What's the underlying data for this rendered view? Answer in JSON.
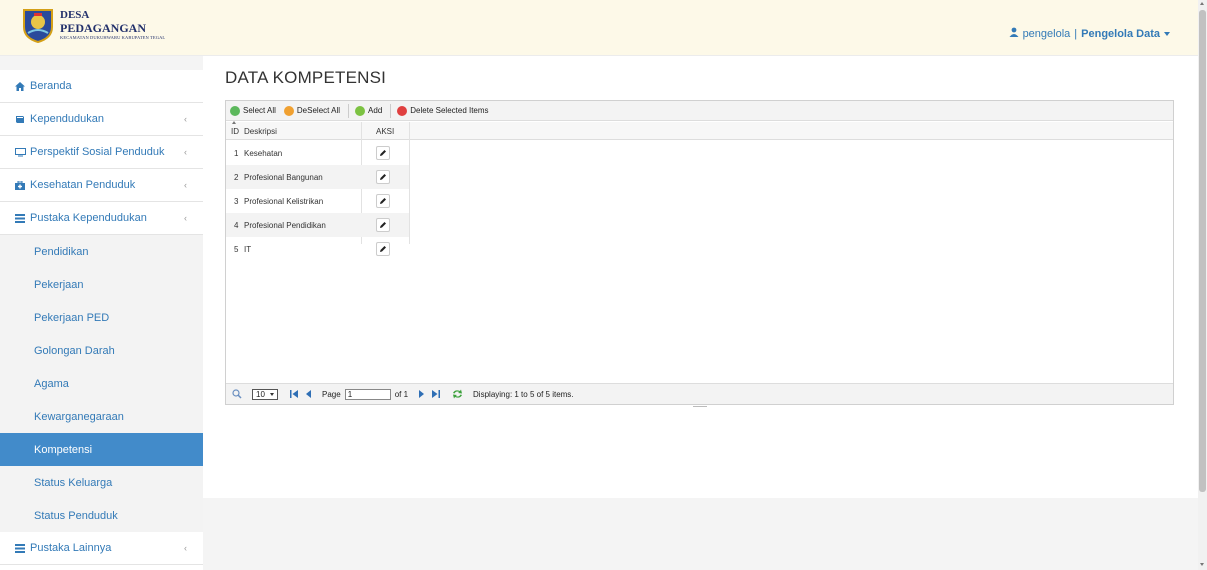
{
  "header": {
    "logo_line1": "DESA",
    "logo_line2": "PEDAGANGAN",
    "logo_line3": "KECAMATAN DUKUHWARU KABUPATEN TEGAL",
    "username": "pengelola",
    "separator": "|",
    "role": "Pengelola Data"
  },
  "sidebar": {
    "items": [
      {
        "label": "Beranda",
        "icon": "home-icon"
      },
      {
        "label": "Kependudukan",
        "icon": "book-icon"
      },
      {
        "label": "Perspektif Sosial Penduduk",
        "icon": "monitor-icon"
      },
      {
        "label": "Kesehatan Penduduk",
        "icon": "medkit-icon"
      },
      {
        "label": "Pustaka Kependudukan",
        "icon": "list-icon"
      }
    ],
    "sub_items": [
      {
        "label": "Pendidikan"
      },
      {
        "label": "Pekerjaan"
      },
      {
        "label": "Pekerjaan PED"
      },
      {
        "label": "Golongan Darah"
      },
      {
        "label": "Agama"
      },
      {
        "label": "Kewarganegaraan"
      },
      {
        "label": "Kompetensi",
        "active": true
      },
      {
        "label": "Status Keluarga"
      },
      {
        "label": "Status Penduduk"
      }
    ],
    "last_item": {
      "label": "Pustaka Lainnya",
      "icon": "list-icon"
    }
  },
  "main": {
    "title": "DATA KOMPETENSI",
    "toolbar": {
      "select_all": "Select All",
      "deselect_all": "DeSelect All",
      "add": "Add",
      "delete_selected": "Delete Selected Items"
    },
    "columns": {
      "id": "ID",
      "deskripsi": "Deskripsi",
      "aksi": "AKSI"
    },
    "rows": [
      {
        "id": "1",
        "deskripsi": "Kesehatan"
      },
      {
        "id": "2",
        "deskripsi": "Profesional Bangunan"
      },
      {
        "id": "3",
        "deskripsi": "Profesional Kelistrikan"
      },
      {
        "id": "4",
        "deskripsi": "Profesional Pendidikan"
      },
      {
        "id": "5",
        "deskripsi": "IT"
      }
    ],
    "pager": {
      "page_size": "10",
      "page_label": "Page",
      "page_value": "1",
      "of_label": "of 1",
      "displaying": "Displaying: 1 to 5 of 5 items."
    }
  },
  "colors": {
    "link": "#337ab7",
    "active_bg": "#428bca",
    "header_bg": "#fdf9e8",
    "select_green": "#5cb85c",
    "deselect_orange": "#f0a030",
    "add_green": "#7cc242",
    "delete_red": "#e04040"
  }
}
